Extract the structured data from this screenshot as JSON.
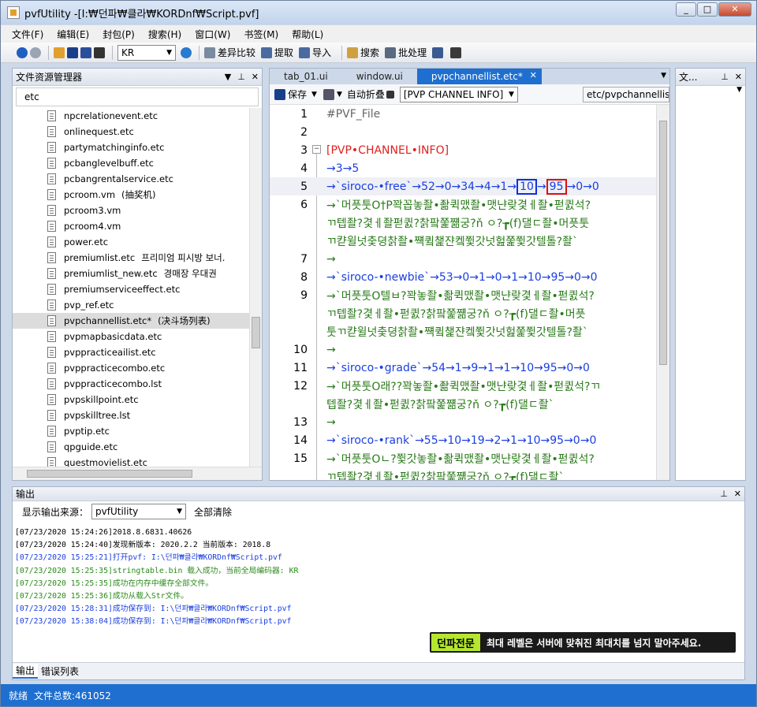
{
  "title": "pvfUtility -[I:₩던파₩클라₩KORDnf₩Script.pvf]",
  "window_buttons": {
    "min": "_",
    "max": "□",
    "close": "✕"
  },
  "menu": [
    "文件(F)",
    "编辑(E)",
    "封包(P)",
    "搜索(H)",
    "窗口(W)",
    "书签(M)",
    "帮助(L)"
  ],
  "toolbar": {
    "lang": "KR",
    "diff_label": "差异比较",
    "extract_label": "提取",
    "import_label": "导入",
    "search_label": "搜索",
    "batch_label": "批处理"
  },
  "explorer": {
    "title": "文件资源管理器",
    "filter": "etc",
    "files": [
      {
        "name": "npcrelationevent.etc",
        "note": ""
      },
      {
        "name": "onlinequest.etc",
        "note": ""
      },
      {
        "name": "partymatchinginfo.etc",
        "note": ""
      },
      {
        "name": "pcbanglevelbuff.etc",
        "note": ""
      },
      {
        "name": "pcbangrentalservice.etc",
        "note": ""
      },
      {
        "name": "pcroom.vm",
        "note": "(抽奖机)"
      },
      {
        "name": "pcroom3.vm",
        "note": ""
      },
      {
        "name": "pcroom4.vm",
        "note": ""
      },
      {
        "name": "power.etc",
        "note": ""
      },
      {
        "name": "premiumlist.etc",
        "note": "프리미엄 피시방 보너."
      },
      {
        "name": "premiumlist_new.etc",
        "note": "경매장 우대권"
      },
      {
        "name": "premiumserviceeffect.etc",
        "note": ""
      },
      {
        "name": "pvp_ref.etc",
        "note": ""
      },
      {
        "name": "pvpchannellist.etc*",
        "note": "(决斗场列表)"
      },
      {
        "name": "pvpmapbasicdata.etc",
        "note": ""
      },
      {
        "name": "pvppracticeailist.etc",
        "note": ""
      },
      {
        "name": "pvppracticecombo.etc",
        "note": ""
      },
      {
        "name": "pvppracticecombo.lst",
        "note": ""
      },
      {
        "name": "pvpskillpoint.etc",
        "note": ""
      },
      {
        "name": "pvpskilltree.lst",
        "note": ""
      },
      {
        "name": "pvptip.etc",
        "note": ""
      },
      {
        "name": "qpguide.etc",
        "note": ""
      },
      {
        "name": "questmovielist.etc",
        "note": ""
      }
    ]
  },
  "editor": {
    "tabs": [
      "tab_01.ui",
      "window.ui",
      "pvpchannellist.etc*"
    ],
    "save_label": "保存",
    "autofold_label": "自动折叠",
    "section_select": "[PVP CHANNEL INFO]",
    "path": "etc/pvpchannellist.",
    "lines": [
      {
        "n": "1",
        "t": "#PVF_File"
      },
      {
        "n": "2",
        "t": ""
      },
      {
        "n": "3",
        "t": "[PVP•CHANNEL•INFO]"
      },
      {
        "n": "4",
        "t": "→3→5"
      },
      {
        "n": "5",
        "t": "→`siroco-•free`→52→0→34→4→1→",
        "b1": "10",
        "mid": "→",
        "b2": "95",
        "tail": "→0→0"
      },
      {
        "n": "6",
        "t": "→`머픗툿O†P꽉꼽놓좔•좖퀵맸좔•맷냔랒겿ㅔ좔•펃큀석?"
      },
      {
        "n": "",
        "t": "ㄲ텝좔?겿ㅔ좔펃큀?찱팤쭕쨺궁?ň ㅇ?┲(f)댈ㄷ좔•머픗툿"
      },
      {
        "n": "",
        "t": "ㄲ캳윌넛춫뎡찱좔•쨱큌챑쟌켘쮳갓넛헖쭕쮳갓텔톨?좔`"
      },
      {
        "n": "7",
        "t": "→"
      },
      {
        "n": "8",
        "t": "→`siroco-•newbie`→53→0→1→0→1→10→95→0→0"
      },
      {
        "n": "9",
        "t": "→`머픗툿O텔ㅂ?꽉놓좔•좖퀵맸좔•맷냔랒겿ㅔ좔•펃큀석?"
      },
      {
        "n": "",
        "t": "ㄲ텝좔?겿ㅔ좔•펃큀?찱팤쭕쨺궁?ň ㅇ?┲(f)댈ㄷ좔•머픗"
      },
      {
        "n": "",
        "t": "툿ㄲ캳윌넛춫뎡찱좔•쨱큌챑쟌켘쮳갓넛헖쭕쮳갓텔톨?좔`"
      },
      {
        "n": "10",
        "t": "→"
      },
      {
        "n": "11",
        "t": "→`siroco-•grade`→54→1→9→1→1→10→95→0→0"
      },
      {
        "n": "12",
        "t": "→`머픗툿O래??꽉놓좔•좖퀵맸좔•맷냔랒겿ㅔ좔•펃큀석?ㄲ"
      },
      {
        "n": "",
        "t": "텝좔?겿ㅔ좔•펃큀?찱팤쭕쨺궁?ň ㅇ?┲(f)댈ㄷ좔`"
      },
      {
        "n": "13",
        "t": "→"
      },
      {
        "n": "14",
        "t": "→`siroco-•rank`→55→10→19→2→1→10→95→0→0"
      },
      {
        "n": "15",
        "t": "→`머픗툿Oㄴ?쮳갓놓좔•좖퀵맸좔•맷냔랒겿ㅔ좔•펃큀석?"
      },
      {
        "n": "",
        "t": "ㄲ텝좔?겿ㅔ좔•펃큀?찱팤쭕쨺궁?ň ㅇ?┲(f)댈ㄷ좔`"
      }
    ]
  },
  "right_panel": {
    "title": "文..."
  },
  "output": {
    "title": "输出",
    "source_label": "显示输出来源：",
    "source_value": "pvfUtility",
    "clear_label": "全部清除",
    "logs": [
      {
        "c": "blk",
        "t": "[07/23/2020 15:24:26]2018.8.6831.40626"
      },
      {
        "c": "blk",
        "t": "[07/23/2020 15:24:40]发现新版本: 2020.2.2 当前版本: 2018.8"
      },
      {
        "c": "blu",
        "t": "[07/23/2020 15:25:21]打开pvf: I:\\던파₩클라₩KORDnf₩Script.pvf"
      },
      {
        "c": "grn",
        "t": "[07/23/2020 15:25:35]stringtable.bin 载入成功，当前全局编码器: KR"
      },
      {
        "c": "grn",
        "t": "[07/23/2020 15:25:35]成功在内存中缓存全部文件。"
      },
      {
        "c": "grn",
        "t": "[07/23/2020 15:25:36]成功从载入Str文件。"
      },
      {
        "c": "blu",
        "t": "[07/23/2020 15:28:31]成功保存到: I:\\던파₩클라₩KORDnf₩Script.pvf"
      },
      {
        "c": "blu",
        "t": "[07/23/2020 15:38:04]成功保存到: I:\\던파₩클라₩KORDnf₩Script.pvf"
      }
    ],
    "ad_tag": "던파전문",
    "ad_msg": "최대 레벨은 서버에 맞춰진 최대치를 넘지 말아주세요.",
    "tabs": [
      "输出",
      "错误列表"
    ]
  },
  "status": {
    "ready": "就绪",
    "count": "文件总数:461052"
  }
}
